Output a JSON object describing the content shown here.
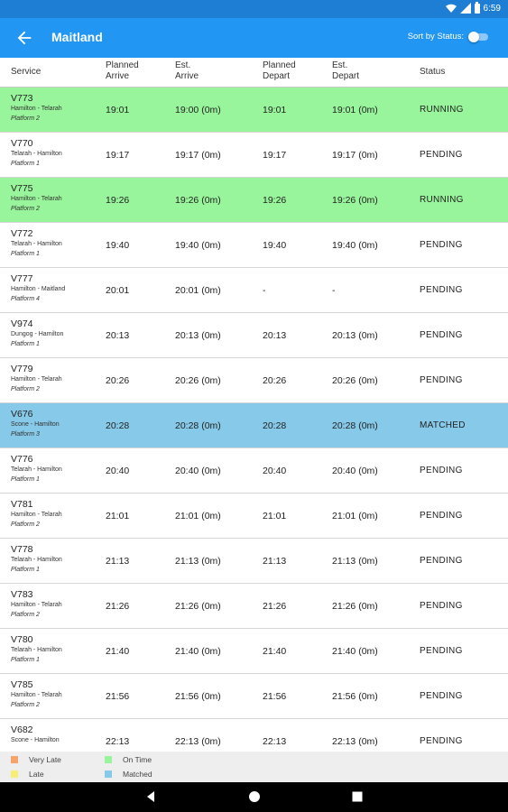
{
  "status_bar": {
    "time": "6:59"
  },
  "app_bar": {
    "title": "Maitland",
    "sort_label": "Sort by Status:"
  },
  "colors": {
    "running": "#98f59b",
    "matched": "#87c9e8",
    "pending": "#ffffff",
    "very_late": "#f7a36e",
    "late": "#f6ee7a"
  },
  "columns": [
    {
      "line1": "Service",
      "line2": ""
    },
    {
      "line1": "Planned",
      "line2": "Arrive"
    },
    {
      "line1": "Est.",
      "line2": "Arrive"
    },
    {
      "line1": "Planned",
      "line2": "Depart"
    },
    {
      "line1": "Est.",
      "line2": "Depart"
    },
    {
      "line1": "Status",
      "line2": ""
    }
  ],
  "rows": [
    {
      "service": "V773",
      "route": "Hamilton - Telarah",
      "platform": "Platform 2",
      "planned_arrive": "19:01",
      "est_arrive": "19:00 (0m)",
      "planned_depart": "19:01",
      "est_depart": "19:01 (0m)",
      "status": "RUNNING"
    },
    {
      "service": "V770",
      "route": "Telarah - Hamilton",
      "platform": "Platform 1",
      "planned_arrive": "19:17",
      "est_arrive": "19:17 (0m)",
      "planned_depart": "19:17",
      "est_depart": "19:17 (0m)",
      "status": "PENDING"
    },
    {
      "service": "V775",
      "route": "Hamilton - Telarah",
      "platform": "Platform 2",
      "planned_arrive": "19:26",
      "est_arrive": "19:26 (0m)",
      "planned_depart": "19:26",
      "est_depart": "19:26 (0m)",
      "status": "RUNNING"
    },
    {
      "service": "V772",
      "route": "Telarah - Hamilton",
      "platform": "Platform 1",
      "planned_arrive": "19:40",
      "est_arrive": "19:40 (0m)",
      "planned_depart": "19:40",
      "est_depart": "19:40 (0m)",
      "status": "PENDING"
    },
    {
      "service": "V777",
      "route": "Hamilton - Maitland",
      "platform": "Platform 4",
      "planned_arrive": "20:01",
      "est_arrive": "20:01 (0m)",
      "planned_depart": "-",
      "est_depart": "-",
      "status": "PENDING"
    },
    {
      "service": "V974",
      "route": "Dungog - Hamilton",
      "platform": "Platform 1",
      "planned_arrive": "20:13",
      "est_arrive": "20:13 (0m)",
      "planned_depart": "20:13",
      "est_depart": "20:13 (0m)",
      "status": "PENDING"
    },
    {
      "service": "V779",
      "route": "Hamilton - Telarah",
      "platform": "Platform 2",
      "planned_arrive": "20:26",
      "est_arrive": "20:26 (0m)",
      "planned_depart": "20:26",
      "est_depart": "20:26 (0m)",
      "status": "PENDING"
    },
    {
      "service": "V676",
      "route": "Scone - Hamilton",
      "platform": "Platform 3",
      "planned_arrive": "20:28",
      "est_arrive": "20:28 (0m)",
      "planned_depart": "20:28",
      "est_depart": "20:28 (0m)",
      "status": "MATCHED"
    },
    {
      "service": "V776",
      "route": "Telarah - Hamilton",
      "platform": "Platform 1",
      "planned_arrive": "20:40",
      "est_arrive": "20:40 (0m)",
      "planned_depart": "20:40",
      "est_depart": "20:40 (0m)",
      "status": "PENDING"
    },
    {
      "service": "V781",
      "route": "Hamilton - Telarah",
      "platform": "Platform 2",
      "planned_arrive": "21:01",
      "est_arrive": "21:01 (0m)",
      "planned_depart": "21:01",
      "est_depart": "21:01 (0m)",
      "status": "PENDING"
    },
    {
      "service": "V778",
      "route": "Telarah - Hamilton",
      "platform": "Platform 1",
      "planned_arrive": "21:13",
      "est_arrive": "21:13 (0m)",
      "planned_depart": "21:13",
      "est_depart": "21:13 (0m)",
      "status": "PENDING"
    },
    {
      "service": "V783",
      "route": "Hamilton - Telarah",
      "platform": "Platform 2",
      "planned_arrive": "21:26",
      "est_arrive": "21:26 (0m)",
      "planned_depart": "21:26",
      "est_depart": "21:26 (0m)",
      "status": "PENDING"
    },
    {
      "service": "V780",
      "route": "Telarah - Hamilton",
      "platform": "Platform 1",
      "planned_arrive": "21:40",
      "est_arrive": "21:40 (0m)",
      "planned_depart": "21:40",
      "est_depart": "21:40 (0m)",
      "status": "PENDING"
    },
    {
      "service": "V785",
      "route": "Hamilton - Telarah",
      "platform": "Platform 2",
      "planned_arrive": "21:56",
      "est_arrive": "21:56 (0m)",
      "planned_depart": "21:56",
      "est_depart": "21:56 (0m)",
      "status": "PENDING"
    },
    {
      "service": "V682",
      "route": "Scone - Hamilton",
      "platform": "",
      "planned_arrive": "22:13",
      "est_arrive": "22:13 (0m)",
      "planned_depart": "22:13",
      "est_depart": "22:13 (0m)",
      "status": "PENDING"
    }
  ],
  "legend": [
    {
      "label": "Very Late",
      "color": "#f7a36e"
    },
    {
      "label": "On Time",
      "color": "#98f59b"
    },
    {
      "label": "Late",
      "color": "#f6ee7a"
    },
    {
      "label": "Matched",
      "color": "#87c9e8"
    }
  ],
  "nav_icons": [
    "back-icon",
    "home-icon",
    "recents-icon"
  ]
}
